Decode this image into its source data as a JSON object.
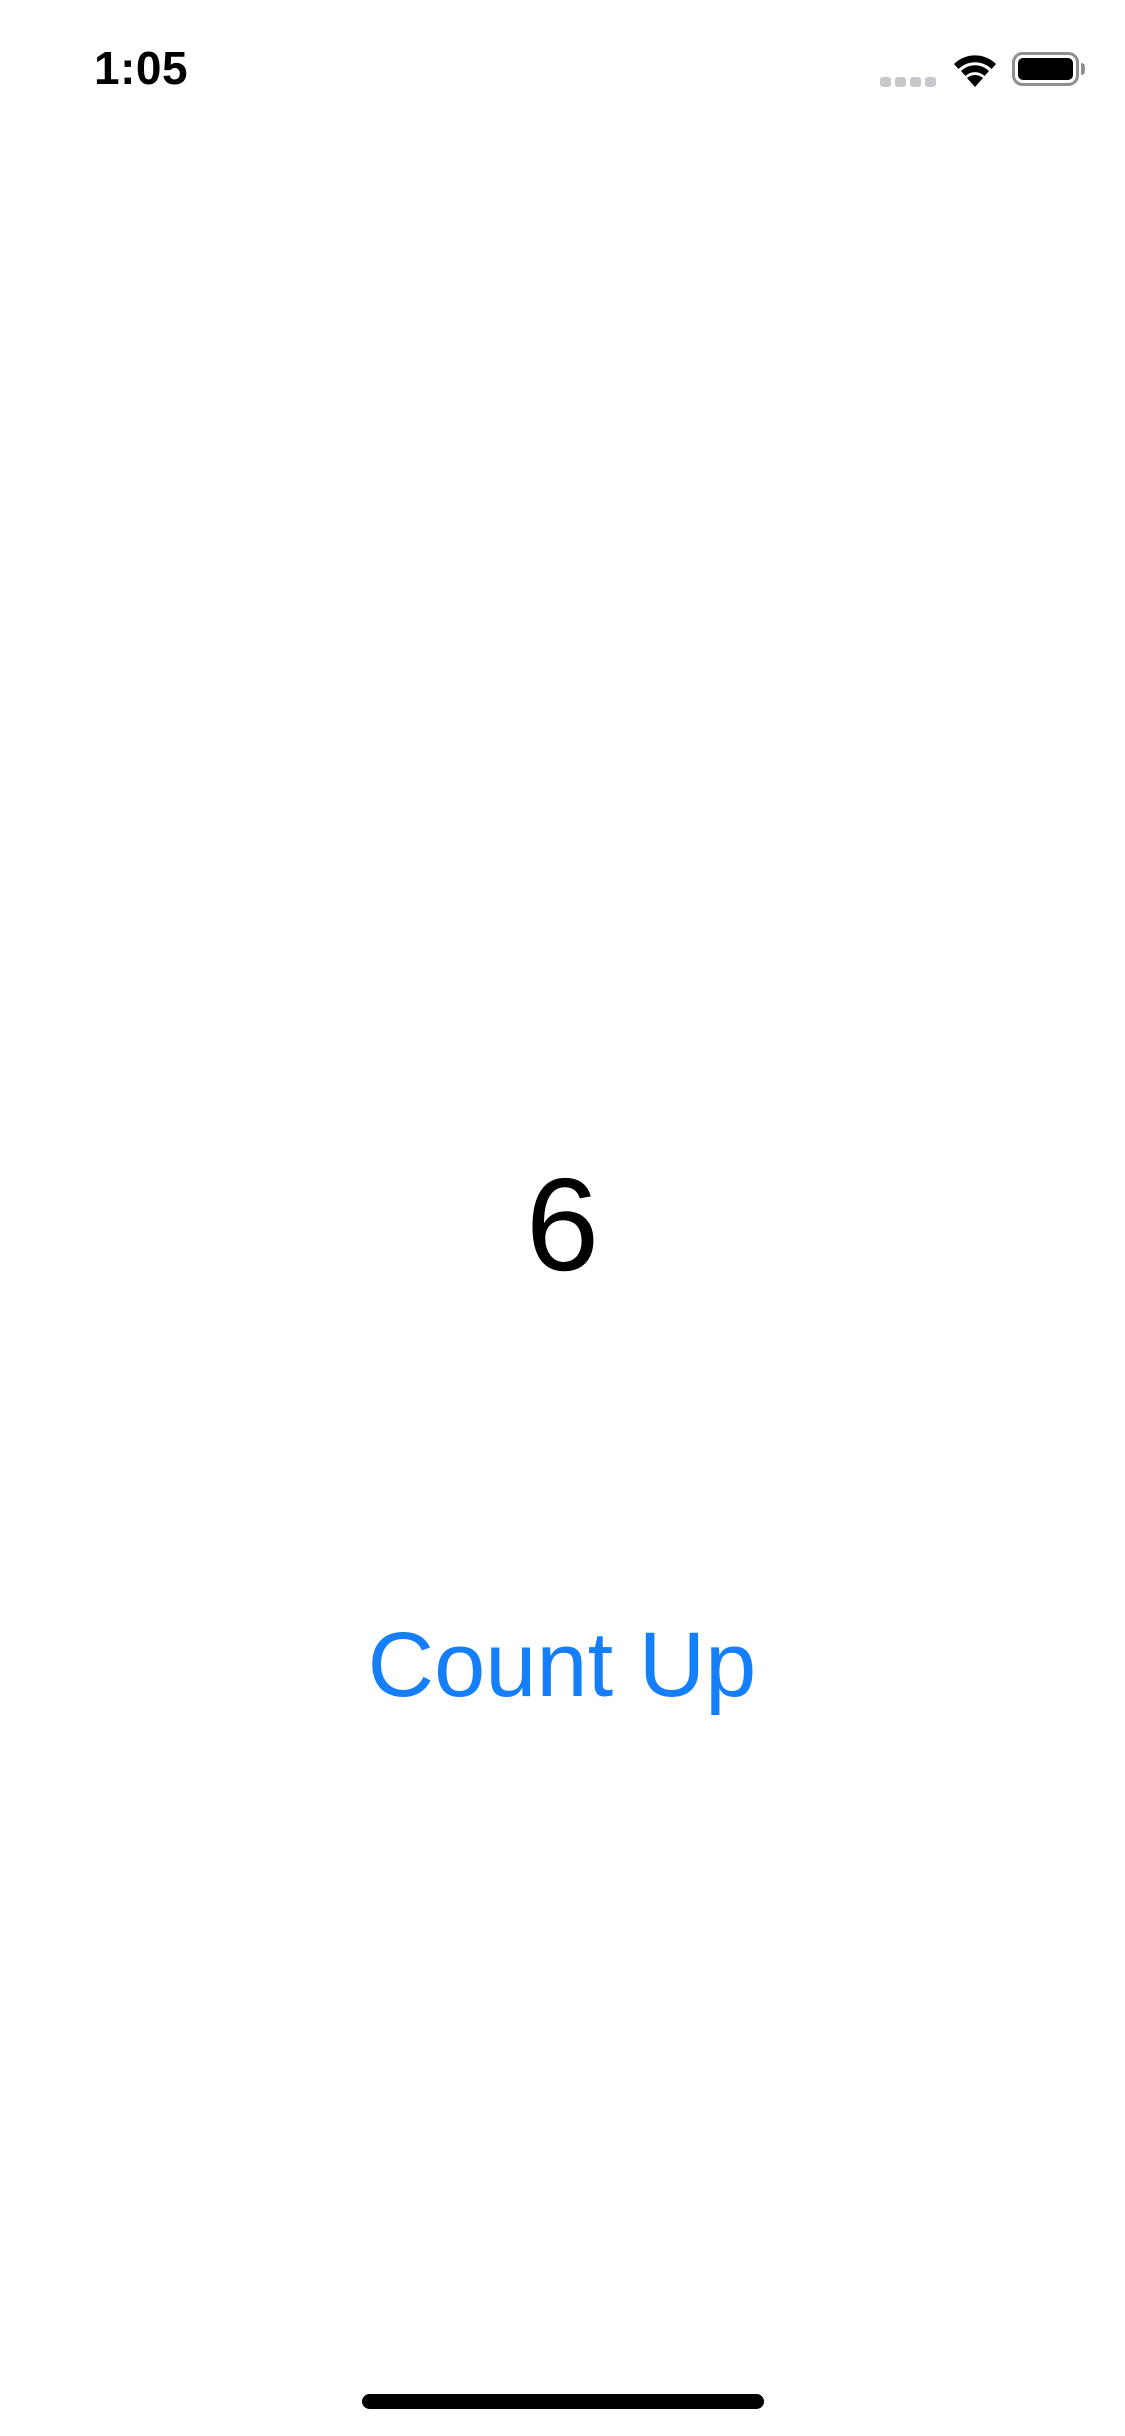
{
  "status_bar": {
    "time": "1:05",
    "signal_icon": "cellular-signal-icon",
    "wifi_icon": "wifi-icon",
    "battery_icon": "battery-icon"
  },
  "counter": {
    "value": "6"
  },
  "count_up_button": {
    "label": "Count Up"
  },
  "colors": {
    "accent": "#147efb",
    "text": "#000000",
    "background": "#ffffff",
    "signal_inactive": "#c7c7cc"
  },
  "home_indicator": {
    "icon": "home-indicator"
  }
}
